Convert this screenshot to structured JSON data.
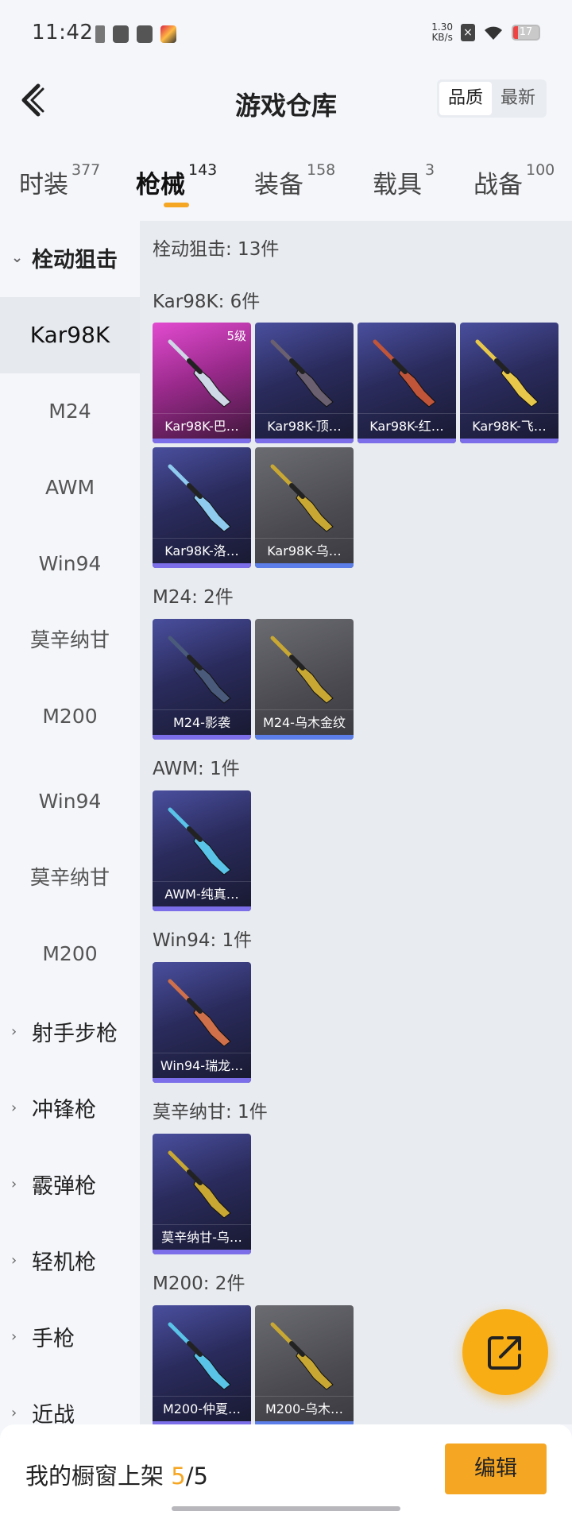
{
  "status_bar": {
    "time": "11:42",
    "speed_value": "1.30",
    "speed_unit": "KB/s",
    "battery_level": "17"
  },
  "header": {
    "title": "游戏仓库",
    "sort_options": [
      "品质",
      "最新"
    ],
    "active_sort": "品质"
  },
  "category_tabs": [
    {
      "label": "时装",
      "count": "377"
    },
    {
      "label": "枪械",
      "count": "143"
    },
    {
      "label": "装备",
      "count": "158"
    },
    {
      "label": "载具",
      "count": "3"
    },
    {
      "label": "战备",
      "count": "100"
    }
  ],
  "active_category": "枪械",
  "sidebar": {
    "expanded_group": "栓动狙击",
    "sub_items": [
      "Kar98K",
      "M24",
      "AWM",
      "Win94",
      "莫辛纳甘",
      "M200",
      "Win94",
      "莫辛纳甘",
      "M200"
    ],
    "selected_sub_item": "Kar98K",
    "collapsed_groups": [
      "射手步枪",
      "冲锋枪",
      "霰弹枪",
      "轻机枪",
      "手枪",
      "近战"
    ]
  },
  "content": {
    "group_summary": "栓动狙击: 13件",
    "sections": [
      {
        "title": "Kar98K: 6件",
        "items": [
          {
            "label": "Kar98K-巴…",
            "rarity": "pink",
            "level": "5级",
            "gun_color": "#cfd8e6"
          },
          {
            "label": "Kar98K-顶…",
            "rarity": "purple",
            "gun_color": "#6a6070"
          },
          {
            "label": "Kar98K-红…",
            "rarity": "purple",
            "gun_color": "#c0553a"
          },
          {
            "label": "Kar98K-飞…",
            "rarity": "purple",
            "gun_color": "#e8c84a"
          },
          {
            "label": "Kar98K-洛…",
            "rarity": "purple",
            "gun_color": "#8ecbef"
          },
          {
            "label": "Kar98K-乌…",
            "rarity": "gray",
            "gun_color": "#c8a832"
          }
        ]
      },
      {
        "title": "M24: 2件",
        "items": [
          {
            "label": "M24-影袭",
            "rarity": "purple",
            "gun_color": "#4a5a7a"
          },
          {
            "label": "M24-乌木金纹",
            "rarity": "gray",
            "gun_color": "#c8a832"
          }
        ]
      },
      {
        "title": "AWM: 1件",
        "items": [
          {
            "label": "AWM-纯真…",
            "rarity": "purple",
            "gun_color": "#59c3e8"
          }
        ]
      },
      {
        "title": "Win94: 1件",
        "items": [
          {
            "label": "Win94-瑞龙…",
            "rarity": "purple",
            "gun_color": "#d0704a"
          }
        ]
      },
      {
        "title": "莫辛纳甘: 1件",
        "items": [
          {
            "label": "莫辛纳甘-乌…",
            "rarity": "purple",
            "gun_color": "#c8a832"
          }
        ]
      },
      {
        "title": "M200: 2件",
        "items": [
          {
            "label": "M200-仲夏…",
            "rarity": "purple",
            "gun_color": "#59c3e8"
          },
          {
            "label": "M200-乌木…",
            "rarity": "gray",
            "gun_color": "#c8a832"
          }
        ]
      }
    ]
  },
  "bottom_bar": {
    "shelf_label": "我的橱窗上架",
    "shelf_current": "5",
    "shelf_separator": "/",
    "shelf_total": "5",
    "edit_label": "编辑"
  },
  "colors": {
    "accent": "#f5a623",
    "fab": "#f9ad15",
    "rarity_pink": "#e24bd0",
    "rarity_purple": "#4a4f9e",
    "rarity_gray": "#6b6b72"
  }
}
